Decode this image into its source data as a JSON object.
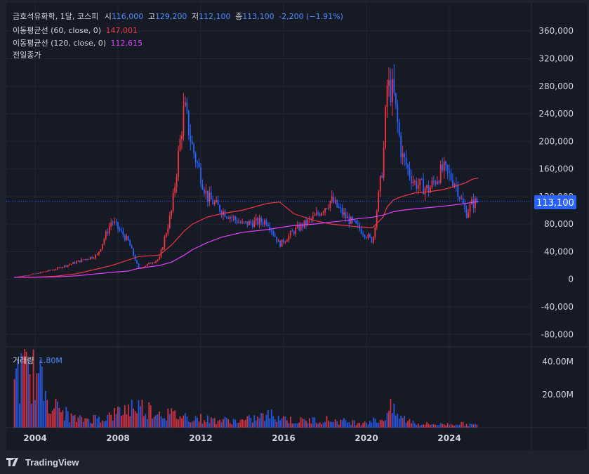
{
  "header": {
    "symbol": "금호석유화학, 1달, 코스피",
    "open_label": "시",
    "open_value": "116,000",
    "high_label": "고",
    "high_value": "129,200",
    "low_label": "저",
    "low_value": "112,100",
    "close_label": "종",
    "close_value": "113,100",
    "change": "-2,200 (−1.91%)"
  },
  "indicators": [
    {
      "label": "이동평균선 (60, close, 0)",
      "value": "147,001",
      "color": "#f23645"
    },
    {
      "label": "이동평균선 (120, close, 0)",
      "value": "112,615",
      "color": "#e040fb"
    },
    {
      "label": "전일종가",
      "value": ""
    }
  ],
  "volume_pane": {
    "label": "거래량",
    "value": "1.80M"
  },
  "price_badge": "113,100",
  "brand": "TradingView",
  "colors": {
    "up": "#f23645",
    "down": "#2962ff",
    "ma60": "#f23645",
    "ma120": "#e040fb",
    "badge": "#2962ff",
    "background": "#161a25"
  },
  "chart_data": [
    {
      "type": "line",
      "subtype": "candlestick-monthly",
      "x_ticks": [
        "2004",
        "2008",
        "2012",
        "2016",
        "2020",
        "2024"
      ],
      "y_ticks": [
        "360,000",
        "320,000",
        "280,000",
        "240,000",
        "200,000",
        "160,000",
        "120,000",
        "80,000",
        "40,000",
        "0",
        "-40,000",
        "-80,000"
      ],
      "ylim": [
        -90000,
        380000
      ],
      "grid": true,
      "last_price": 113100,
      "x": [
        2003.0,
        2004.0,
        2005.0,
        2006.0,
        2007.0,
        2007.7,
        2008.5,
        2009.0,
        2010.0,
        2010.6,
        2011.2,
        2011.6,
        2012.3,
        2013.0,
        2014.0,
        2015.2,
        2015.8,
        2016.5,
        2017.5,
        2018.3,
        2019.0,
        2019.6,
        2020.3,
        2020.8,
        2021.0,
        2021.3,
        2021.7,
        2022.3,
        2023.0,
        2023.7,
        2024.3,
        2024.8,
        2025.1,
        2025.4
      ],
      "series": [
        {
          "name": "close",
          "values": [
            3000,
            8000,
            15000,
            25000,
            35000,
            85000,
            55000,
            15000,
            30000,
            100000,
            250000,
            190000,
            120000,
            100000,
            80000,
            85000,
            50000,
            70000,
            90000,
            115000,
            90000,
            75000,
            55000,
            170000,
            280000,
            270000,
            180000,
            140000,
            130000,
            160000,
            140000,
            95000,
            110000,
            113100
          ]
        },
        {
          "name": "이동평균선 (60, close, 0)",
          "values": [
            3000,
            3200,
            4500,
            8000,
            15000,
            20000,
            28000,
            33000,
            35000,
            50000,
            70000,
            80000,
            90000,
            95000,
            100000,
            110000,
            112000,
            95000,
            85000,
            80000,
            78000,
            76000,
            75000,
            90000,
            105000,
            115000,
            120000,
            125000,
            127000,
            130000,
            135000,
            140000,
            145000,
            147001
          ]
        },
        {
          "name": "이동평균선 (120, close, 0)",
          "values": [
            3000,
            3000,
            3500,
            5000,
            8000,
            10000,
            12000,
            16000,
            20000,
            25000,
            35000,
            43000,
            53000,
            61000,
            68000,
            72000,
            75000,
            78000,
            80000,
            83000,
            85000,
            88000,
            90000,
            93000,
            95000,
            98000,
            100000,
            102000,
            104000,
            106000,
            108000,
            110000,
            111500,
            112615
          ]
        }
      ]
    },
    {
      "type": "bar",
      "name": "거래량",
      "y_ticks": [
        "40.00M",
        "20.00M"
      ],
      "ylim": [
        0,
        45000000
      ],
      "x": [
        2004.0,
        2005.0,
        2006.0,
        2007.5,
        2008.8,
        2009.5,
        2010.5,
        2011.5,
        2012.5,
        2014.0,
        2015.5,
        2016.5,
        2018.0,
        2019.5,
        2020.8,
        2021.1,
        2021.6,
        2022.5,
        2023.5,
        2024.5,
        2025.4
      ],
      "values": [
        40000000,
        15000000,
        6000000,
        8000000,
        17000000,
        14000000,
        10000000,
        8000000,
        6000000,
        5000000,
        10000000,
        5000000,
        6000000,
        4000000,
        6000000,
        15000000,
        8000000,
        3000000,
        2500000,
        3000000,
        1800000
      ]
    }
  ]
}
